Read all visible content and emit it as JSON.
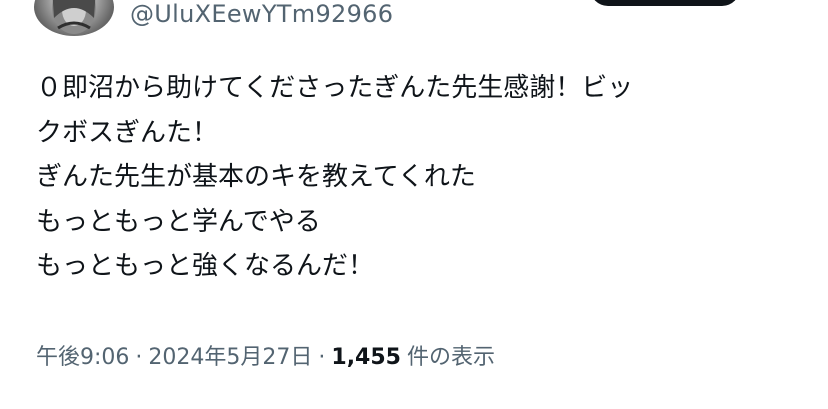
{
  "author": {
    "handle": "@UluXEewYTm92966"
  },
  "tweet": {
    "lines": [
      "０即沼から助けてくださったぎんた先生感謝！ビッ",
      "クボスぎんた！",
      "ぎんた先生が基本のキを教えてくれた",
      "もっともっと学んでやる",
      "もっともっと強くなるんだ！"
    ]
  },
  "meta": {
    "time": "午後9:06",
    "separator": "·",
    "date": "2024年5月27日",
    "views_count": "1,455",
    "views_label": "件の表示"
  },
  "colors": {
    "text_primary": "#0f1419",
    "text_secondary": "#536471",
    "button": "#0f1419"
  }
}
